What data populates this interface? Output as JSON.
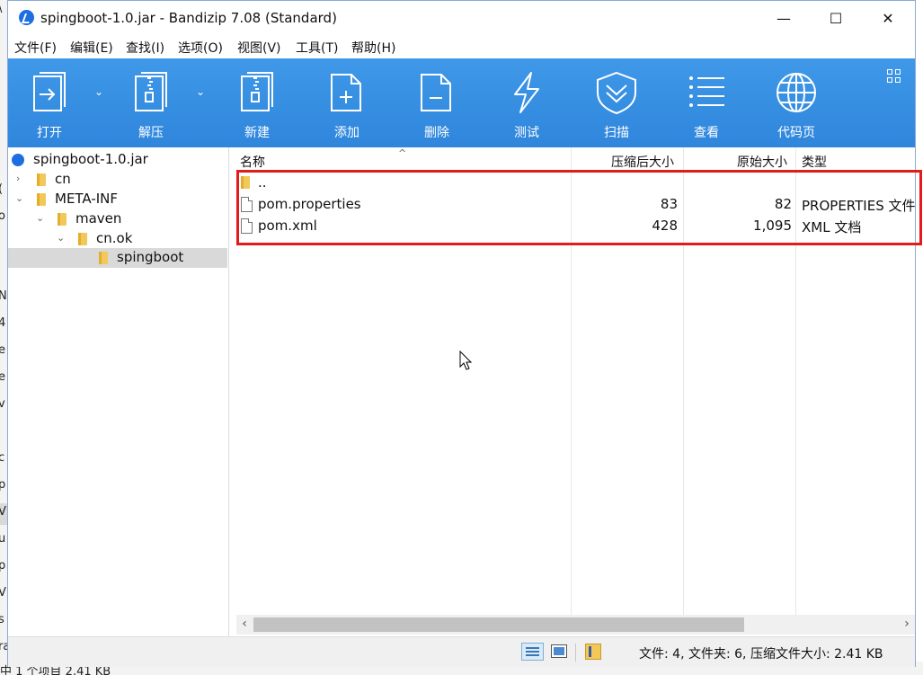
{
  "window": {
    "title": "spingboot-1.0.jar - Bandizip 7.08 (Standard)",
    "minimize_icon": "—",
    "maximize_icon": "☐",
    "close_icon": "✕"
  },
  "menu": [
    "文件(F)",
    "编辑(E)",
    "查找(I)",
    "选项(O)",
    "视图(V)",
    "工具(T)",
    "帮助(H)"
  ],
  "toolbar": {
    "open": "打开",
    "extract": "解压",
    "new": "新建",
    "add": "添加",
    "delete": "删除",
    "test": "测试",
    "scan": "扫描",
    "view": "查看",
    "codepage": "代码页"
  },
  "tree": {
    "root": "spingboot-1.0.jar",
    "items": [
      "cn",
      "META-INF",
      "maven",
      "cn.ok",
      "spingboot"
    ]
  },
  "columns": {
    "name": "名称",
    "compressed": "压缩后大小",
    "original": "原始大小",
    "type": "类型"
  },
  "files": [
    {
      "name": "..",
      "compressed": "",
      "original": "",
      "type": ""
    },
    {
      "name": "pom.properties",
      "compressed": "83",
      "original": "82",
      "type": "PROPERTIES 文件"
    },
    {
      "name": "pom.xml",
      "compressed": "428",
      "original": "1,095",
      "type": "XML 文档"
    }
  ],
  "status": {
    "summary": "文件: 4, 文件夹: 6, 压缩文件大小: 2.41 KB"
  },
  "background": {
    "bottom_text": "中 1 个项目 2.41 KB",
    "left_chars": [
      "\\",
      "(",
      "o",
      "N",
      "4",
      "e",
      "e",
      "v",
      "c",
      "p",
      "V",
      "u",
      "p",
      "VI",
      "s",
      "ra"
    ]
  },
  "colors": {
    "toolbar": "#3a90e3",
    "highlight": "#e31b1b",
    "folder": "#f2c85b"
  }
}
